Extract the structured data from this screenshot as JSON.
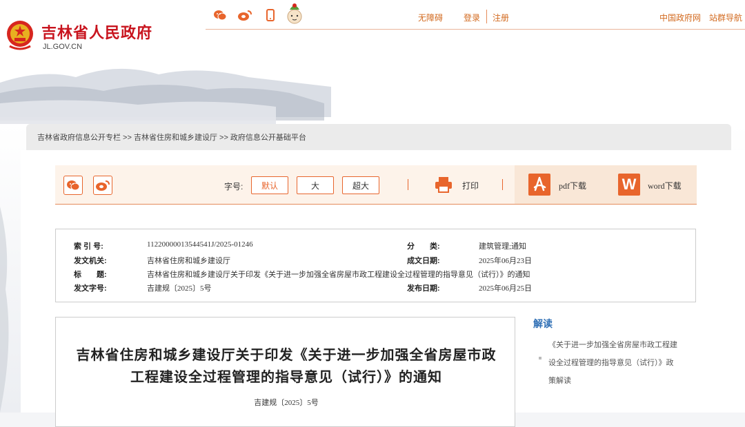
{
  "header": {
    "site_title": "吉林省人民政府",
    "domain": "JL.GOV.CN",
    "links": {
      "accessibility": "无障碍",
      "login": "登录",
      "register": "注册",
      "china_gov": "中国政府网",
      "site_nav": "站群导航"
    },
    "icons": [
      "wechat-icon",
      "weibo-icon",
      "mobile-icon",
      "mascot-icon"
    ]
  },
  "breadcrumb": {
    "text": "吉林省政府信息公开专栏 >> 吉林省住房和城乡建设厅 >> 政府信息公开基础平台"
  },
  "toolbar": {
    "font_size_label": "字号:",
    "font_sizes": [
      "默认",
      "大",
      "超大"
    ],
    "print": "打印",
    "pdf": "pdf下载",
    "word": "word下载",
    "colors": {
      "accent": "#e8652c",
      "toolbar_bg": "#fdf3ea"
    }
  },
  "meta": {
    "index_no_label": "索 引 号:",
    "index_no": "11220000013544541J/2025-01246",
    "category_label": "分　　类:",
    "category": "建筑管理;通知",
    "issuer_label": "发文机关:",
    "issuer": "吉林省住房和城乡建设厅",
    "created_label": "成文日期:",
    "created": "2025年06月23日",
    "title_label": "标　　题:",
    "title": "吉林省住房和城乡建设厅关于印发《关于进一步加强全省房屋市政工程建设全过程管理的指导意见（试行）》的通知",
    "doc_no_label": "发文字号:",
    "doc_no": "吉建规〔2025〕5号",
    "published_label": "发布日期:",
    "published": "2025年06月25日"
  },
  "article": {
    "title_line1": "吉林省住房和城乡建设厅关于印发《关于进一步加强全省房屋市政",
    "title_line2": "工程建设全过程管理的指导意见（试行）》的通知",
    "doc_no": "吉建规〔2025〕5号"
  },
  "sidebar": {
    "heading": "解读",
    "item_line1": "《关于进一步加强全省房屋市政工程建",
    "item_line2": "设全过程管理的指导意见（试行）》政",
    "item_line3": "策解读"
  }
}
